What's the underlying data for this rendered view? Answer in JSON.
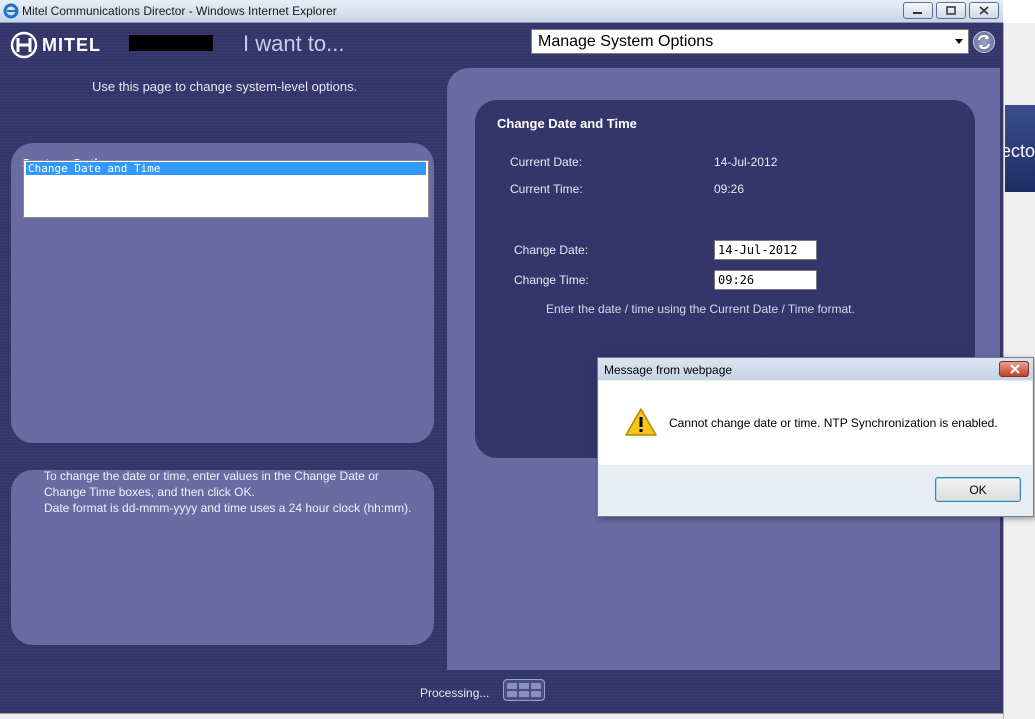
{
  "window": {
    "title": "Mitel Communications Director - Windows Internet Explorer"
  },
  "header": {
    "logo": "MITEL",
    "i_want_to": "I want to...",
    "selected_option": "Manage System Options"
  },
  "intro": "Use this page to change system-level options.",
  "system_options": {
    "title": "System Options",
    "items": [
      "Change Date and Time"
    ]
  },
  "help": {
    "lines": [
      "To change the date or time, enter values in the Change Date or Change Time boxes, and then click OK.",
      "Date format is dd-mmm-yyyy and time uses a 24 hour clock (hh:mm)."
    ]
  },
  "date_time": {
    "title": "Change Date and Time",
    "current_date_label": "Current Date:",
    "current_date": "14-Jul-2012",
    "current_time_label": "Current Time:",
    "current_time": "09:26",
    "change_date_label": "Change Date:",
    "change_date_value": "14-Jul-2012",
    "change_time_label": "Change Time:",
    "change_time_value": "09:26",
    "hint": "Enter the date / time using the Current Date / Time format."
  },
  "status": {
    "processing": "Processing..."
  },
  "background_page": {
    "fragment": "ecto"
  },
  "dialog": {
    "title": "Message from webpage",
    "message": "Cannot change date or time. NTP Synchronization is enabled.",
    "ok": "OK"
  }
}
